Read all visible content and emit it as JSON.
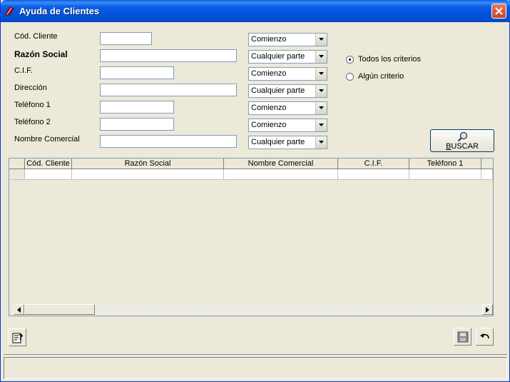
{
  "window": {
    "title": "Ayuda de Clientes"
  },
  "fields": [
    {
      "label": "Cód. Cliente",
      "value": "",
      "match": "Comienzo",
      "bold": false
    },
    {
      "label": "Razón Social",
      "value": "",
      "match": "Cualquier parte",
      "bold": true
    },
    {
      "label": "C.I.F.",
      "value": "",
      "match": "Comienzo",
      "bold": false
    },
    {
      "label": "Dirección",
      "value": "",
      "match": "Cualquier parte",
      "bold": false
    },
    {
      "label": "Teléfono 1",
      "value": "",
      "match": "Comienzo",
      "bold": false
    },
    {
      "label": "Teléfono 2",
      "value": "",
      "match": "Comienzo",
      "bold": false
    },
    {
      "label": "Nombre Comercial",
      "value": "",
      "match": "Cualquier parte",
      "bold": false
    }
  ],
  "criteria": {
    "all_label": "Todos los criterios",
    "any_label": "Algún criterio",
    "selected": "all"
  },
  "search": {
    "label_accel": "B",
    "label_rest": "USCAR"
  },
  "grid": {
    "columns": [
      "Cód. Cliente",
      "Razón Social",
      "Nombre Comercial",
      "C.I.F.",
      "Teléfono 1"
    ]
  },
  "icons": {
    "title": "app-icon",
    "close": "close-icon",
    "search": "magnifier-icon",
    "help": "help-icon",
    "save": "save-icon",
    "undo": "undo-icon"
  },
  "colors": {
    "title_bar": "#0052d8",
    "window_bg": "#ece9d8",
    "input_border": "#7f9db9"
  }
}
